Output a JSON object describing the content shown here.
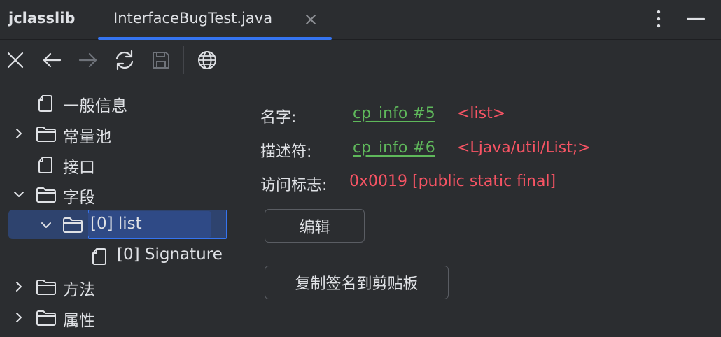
{
  "header": {
    "app_title": "jclasslib",
    "tab_label": "InterfaceBugTest.java"
  },
  "toolbar": {
    "icons": [
      "close-icon",
      "back-arrow-icon",
      "forward-arrow-icon",
      "refresh-icon",
      "save-icon",
      "globe-icon"
    ]
  },
  "tree": {
    "items": [
      {
        "label": "一般信息",
        "icon": "file-icon",
        "expanded": null
      },
      {
        "label": "常量池",
        "icon": "folder-icon",
        "expanded": false
      },
      {
        "label": "接口",
        "icon": "file-icon",
        "expanded": null
      },
      {
        "label": "字段",
        "icon": "folder-icon",
        "expanded": true
      },
      {
        "label": "[0] list",
        "icon": "folder-icon",
        "expanded": true,
        "selected": true
      },
      {
        "label": "[0] Signature",
        "icon": "file-icon",
        "expanded": null
      },
      {
        "label": "方法",
        "icon": "folder-icon",
        "expanded": false
      },
      {
        "label": "属性",
        "icon": "folder-icon",
        "expanded": false
      }
    ]
  },
  "detail": {
    "name_label": "名字:",
    "name_link": "cp_info #5",
    "name_value": "<list>",
    "descriptor_label": "描述符:",
    "descriptor_link": "cp_info #6",
    "descriptor_value": "<Ljava/util/List;>",
    "access_label": "访问标志:",
    "access_value": "0x0019 [public static final]",
    "edit_button": "编辑",
    "copy_signature_button": "复制签名到剪贴板"
  },
  "colors": {
    "background": "#2b2d30",
    "accent": "#3574f0",
    "selection": "#2e436e",
    "link": "#5fb85b",
    "value": "#f75464"
  }
}
